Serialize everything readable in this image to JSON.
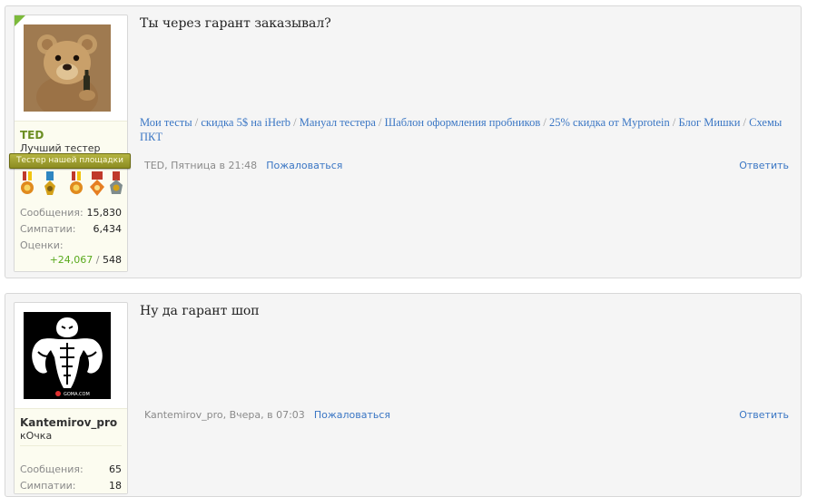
{
  "posts": [
    {
      "author": "TED",
      "user_title": "Лучший тестер",
      "banner": "Тестер нашей площадки",
      "stats": {
        "messages_label": "Сообщения:",
        "messages": "15,830",
        "likes_label": "Симпатии:",
        "likes": "6,434",
        "ratings_label": "Оценки:",
        "ratings_pos": "+24,067",
        "ratings_sep": " / ",
        "ratings_total": "548"
      },
      "message": "Ты через гарант заказывал?",
      "signature": [
        "Мои тесты",
        "скидка 5$ на iHerb",
        "Мануал тестера",
        "Шаблон оформления пробников",
        "25% скидка от Myprotein",
        "Блог Мишки",
        "Схемы ПКТ"
      ],
      "signature_sep": " / ",
      "meta": "TED, Пятница в 21:48",
      "report": "Пожаловаться",
      "reply": "Ответить"
    },
    {
      "author": "Kantemirov_pro",
      "user_title": "кОчка",
      "avatar_caption": "GOMA.COM",
      "stats": {
        "messages_label": "Сообщения:",
        "messages": "65",
        "likes_label": "Симпатии:",
        "likes": "18"
      },
      "message": "Ну да гарант шоп",
      "meta": "Kantemirov_pro, Вчера, в 07:03",
      "report": "Пожаловаться",
      "reply": "Ответить"
    }
  ],
  "colors": {
    "link": "#3a76c4",
    "positive": "#5aaa1e",
    "banner": "#9e9e2c"
  }
}
